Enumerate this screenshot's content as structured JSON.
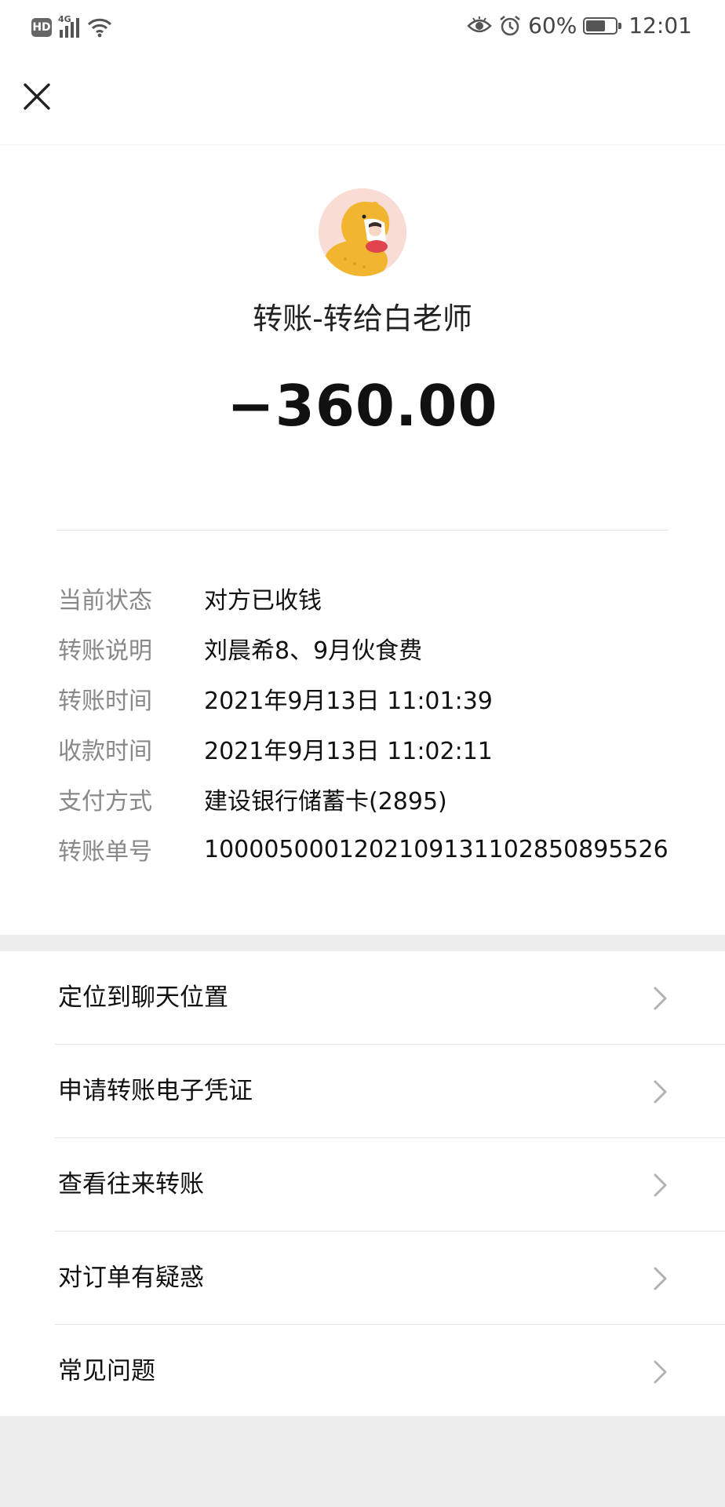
{
  "status_bar": {
    "hd": "HD",
    "network": "4G",
    "battery": "60%",
    "time": "12:01"
  },
  "transfer": {
    "title": "转账-转给白老师",
    "amount": "−360.00"
  },
  "details": [
    {
      "label": "当前状态",
      "value": "对方已收钱"
    },
    {
      "label": "转账说明",
      "value": "刘晨希8、9月伙食费"
    },
    {
      "label": "转账时间",
      "value": "2021年9月13日 11:01:39"
    },
    {
      "label": "收款时间",
      "value": "2021年9月13日 11:02:11"
    },
    {
      "label": "支付方式",
      "value": "建设银行储蓄卡(2895)"
    },
    {
      "label": "转账单号",
      "value": "100005000120210913110285089552​6"
    }
  ],
  "menu": [
    {
      "label": "定位到聊天位置"
    },
    {
      "label": "申请转账电子凭证"
    },
    {
      "label": "查看往来转账"
    },
    {
      "label": "对订单有疑惑"
    },
    {
      "label": "常见问题"
    }
  ],
  "icons": {
    "close": "close-icon",
    "chevron": "chevron-right-icon",
    "eye": "eye-icon",
    "alarm": "alarm-icon",
    "wifi": "wifi-icon"
  }
}
